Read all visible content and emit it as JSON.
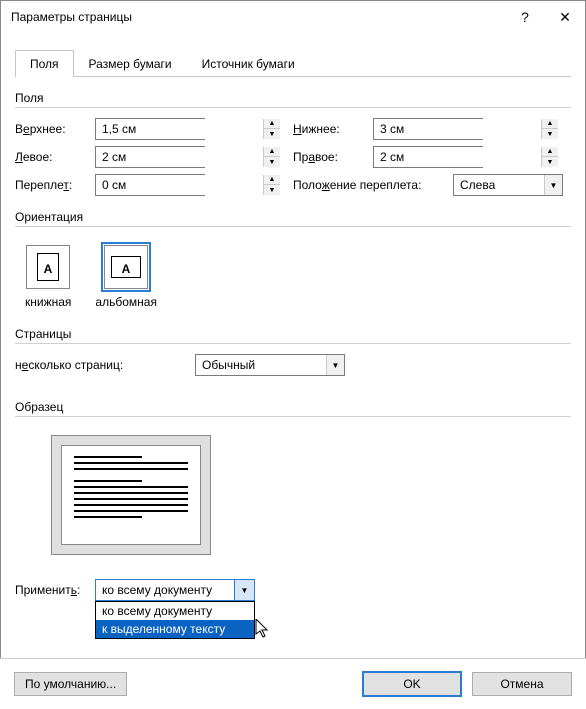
{
  "window": {
    "title": "Параметры страницы"
  },
  "tabs": {
    "margins": "Поля",
    "paper": "Размер бумаги",
    "source": "Источник бумаги"
  },
  "groups": {
    "margins_title": "Поля",
    "orientation_title": "Ориентация",
    "pages_title": "Страницы",
    "sample_title": "Образец"
  },
  "margins": {
    "top": {
      "label_prefix": "В",
      "label_ul": "е",
      "label_suffix": "рхнее:",
      "value": "1,5 см"
    },
    "bottom": {
      "label_ul": "Н",
      "label_suffix": "ижнее:",
      "value": "3 см"
    },
    "left": {
      "label_ul": "Л",
      "label_suffix": "евое:",
      "value": "2 см"
    },
    "right": {
      "label_prefix": "Пр",
      "label_ul": "а",
      "label_suffix": "вое:",
      "value": "2 см"
    },
    "gutter": {
      "label_prefix": "Перепле",
      "label_ul": "т",
      "label_suffix": ":",
      "value": "0 см"
    },
    "gutter_pos": {
      "label_prefix": "Поло",
      "label_ul": "ж",
      "label_suffix": "ение переплета:",
      "value": "Слева"
    }
  },
  "orientation": {
    "portrait": {
      "label_ul": "к",
      "label_suffix": "нижная"
    },
    "landscape": {
      "label_prefix": "а",
      "label_ul": "л",
      "label_suffix": "ьбомная"
    }
  },
  "pages": {
    "multi": {
      "label_prefix": "н",
      "label_ul": "е",
      "label_suffix": "сколько страниц:",
      "value": "Обычный"
    }
  },
  "apply": {
    "label_prefix": "Применит",
    "label_ul": "ь",
    "label_suffix": ":",
    "value": "ко всему документу",
    "options": {
      "0": "ко всему документу",
      "1": "к выделенному тексту"
    }
  },
  "footer": {
    "default": "По умолчанию...",
    "ok": "OK",
    "cancel": "Отмена"
  }
}
